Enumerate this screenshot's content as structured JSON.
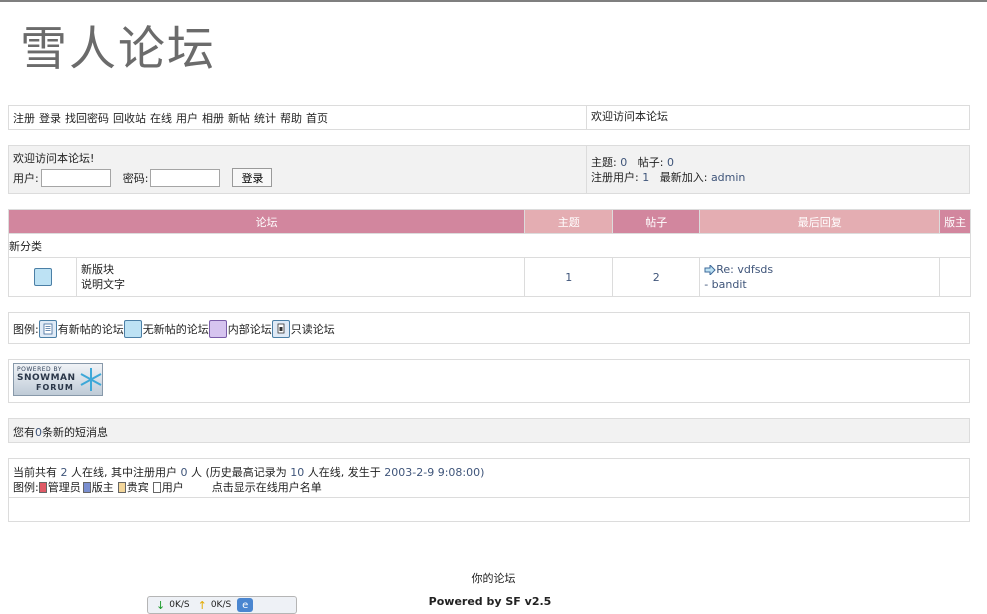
{
  "site": {
    "logo_text": "雪人论坛"
  },
  "nav": {
    "links": [
      "注册",
      "登录",
      "找回密码",
      "回收站",
      "在线",
      "用户",
      "相册",
      "新帖",
      "统计",
      "帮助",
      "首页"
    ],
    "welcome": "欢迎访问本论坛"
  },
  "login": {
    "welcome": "欢迎访问本论坛!",
    "user_label": "用户:",
    "user_value": "",
    "pass_label": "密码:",
    "pass_value": "",
    "submit_label": "登录"
  },
  "stats": {
    "topics_label": "主题:",
    "topics": "0",
    "posts_label": "帖子:",
    "posts": "0",
    "users_label": "注册用户:",
    "users": "1",
    "newest_label": "最新加入:",
    "newest": "admin"
  },
  "forum_table": {
    "headers": {
      "forum": "论坛",
      "topics": "主题",
      "posts": "帖子",
      "last_reply": "最后回复",
      "moderator": "版主"
    },
    "category": "新分类",
    "rows": [
      {
        "icon": "no-new-posts-icon",
        "name": "新版块",
        "description": "说明文字",
        "topics": "1",
        "posts": "2",
        "last_reply_title": "Re: vdfsds",
        "last_reply_by": "- bandit",
        "moderator": ""
      }
    ]
  },
  "legend": {
    "label": "图例:",
    "items": [
      {
        "icon": "new-posts-icon",
        "text": "有新帖的论坛"
      },
      {
        "icon": "no-new-posts-icon",
        "text": "无新帖的论坛"
      },
      {
        "icon": "internal-forum-icon",
        "text": "内部论坛"
      },
      {
        "icon": "readonly-forum-icon",
        "text": "只读论坛"
      }
    ]
  },
  "powered_badge": {
    "line1": "POWERED BY",
    "line2": "SNOWMAN",
    "line3": "FORUM"
  },
  "messages": {
    "prefix": "您有",
    "count": "0",
    "suffix": "条新的短消息"
  },
  "online": {
    "t1": "当前共有",
    "total": "2",
    "t2": "人在线, 其中注册用户",
    "registered": "0",
    "t3": "人 (历史最高记录为",
    "max": "10",
    "t4": "人在线, 发生于",
    "date": "2003-2-9 9:08:00",
    "t5": ")",
    "legend_label": "图例:",
    "legend": [
      {
        "text": "管理员",
        "color": "#e05a66"
      },
      {
        "text": "版主",
        "color": "#7a8fd0"
      },
      {
        "text": "贵宾",
        "color": "#f3d69a"
      },
      {
        "text": "用户",
        "color": "#ffffff"
      }
    ],
    "show_list": "点击显示在线用户名单"
  },
  "footer": {
    "line1": "你的论坛",
    "line2": "Powered by SF v2.5"
  },
  "netbar": {
    "down": "0K/S",
    "up": "0K/S"
  },
  "colors": {
    "header_dark": "#d2869e",
    "header_light": "#e4adb2",
    "value_blue": "#3f557a"
  }
}
